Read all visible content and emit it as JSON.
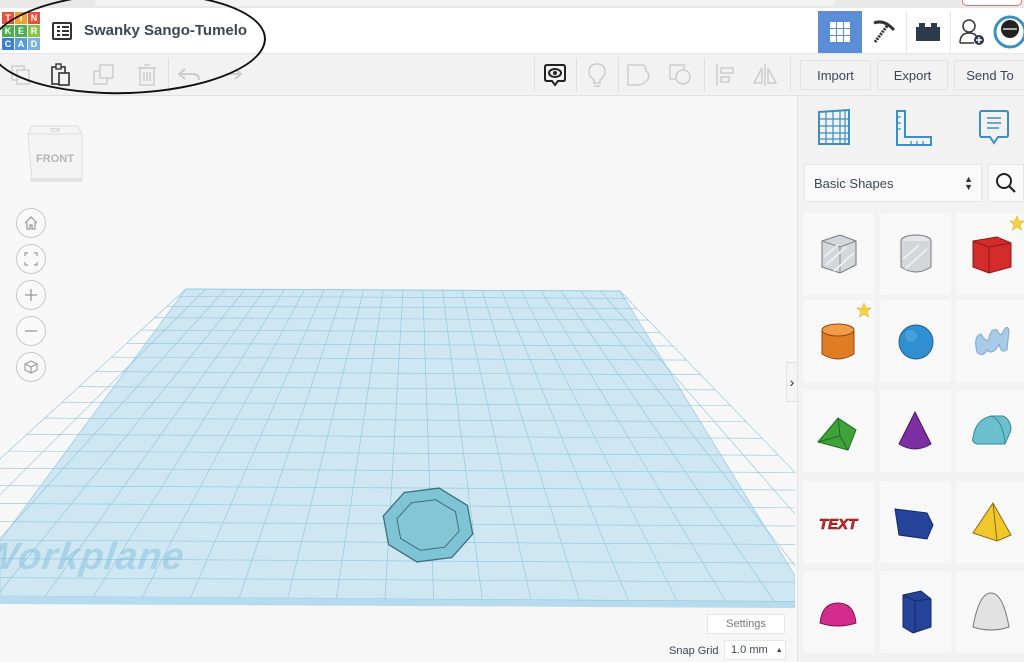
{
  "app": {
    "logo_letters": [
      "T",
      "I",
      "N",
      "K",
      "E",
      "R",
      "C",
      "A",
      "D"
    ],
    "logo_colors": [
      "#e8503a",
      "#f0a030",
      "#e8503a",
      "#4caf50",
      "#4caf50",
      "#8bc34a",
      "#3d7fcf",
      "#5b9bd5",
      "#7ab3e0"
    ]
  },
  "header": {
    "design_title": "Swanky Sango-Tumelo",
    "design_list_icon": "list-icon",
    "view_buttons": [
      {
        "name": "3d-design-view",
        "icon": "grid-icon",
        "active": true
      },
      {
        "name": "codeblocks-view",
        "icon": "pickaxe-icon",
        "active": false
      },
      {
        "name": "bricks-view",
        "icon": "brick-icon",
        "active": false
      },
      {
        "name": "invite-user",
        "icon": "add-user-icon",
        "active": false
      },
      {
        "name": "user-avatar",
        "icon": "avatar-icon",
        "active": false
      }
    ],
    "accent_color": "#5b8ed6"
  },
  "toolbar": {
    "edit_tools": [
      "copy",
      "paste",
      "duplicate",
      "delete"
    ],
    "history_tools": [
      "undo",
      "redo"
    ],
    "view_tools": [
      "show-all-notes",
      "light",
      "group",
      "ungroup",
      "align",
      "mirror"
    ],
    "import_label": "Import",
    "export_label": "Export",
    "send_to_label": "Send To"
  },
  "viewport": {
    "view_cube": {
      "top_label": "TOP",
      "front_label": "FRONT"
    },
    "nav_controls": [
      "home",
      "fit-all",
      "zoom-in",
      "zoom-out",
      "perspective"
    ],
    "workplane_label": "Workplane",
    "object": {
      "shape": "octagon-polygon",
      "color": "#7ec4d4"
    },
    "settings_label": "Settings",
    "snap_grid_label": "Snap Grid",
    "snap_grid_value": "1.0 mm",
    "collapse_handle": "›"
  },
  "panel": {
    "top_icons": [
      "workplane-icon",
      "ruler-icon",
      "notes-icon"
    ],
    "library_select": "Basic Shapes",
    "shapes": [
      {
        "name": "box-hole",
        "color": "#c8ccd2",
        "starred": false
      },
      {
        "name": "cylinder-hole",
        "color": "#c8ccd2",
        "starred": false
      },
      {
        "name": "box",
        "color": "#d42b2b",
        "starred": true
      },
      {
        "name": "cylinder",
        "color": "#e07c24",
        "starred": true
      },
      {
        "name": "sphere",
        "color": "#2f8fd0",
        "starred": false
      },
      {
        "name": "scribble",
        "color": "#a9cbe8",
        "starred": false
      },
      {
        "name": "roof",
        "color": "#3fa23a",
        "starred": false
      },
      {
        "name": "cone",
        "color": "#7b2fa3",
        "starred": false
      },
      {
        "name": "round-roof",
        "color": "#6cbfcc",
        "starred": false
      },
      {
        "name": "text",
        "color": "#d42b2b",
        "starred": false
      },
      {
        "name": "wedge",
        "color": "#26439a",
        "starred": false
      },
      {
        "name": "pyramid",
        "color": "#f1c72c",
        "starred": false
      },
      {
        "name": "half-sphere",
        "color": "#d42b8c",
        "starred": false
      },
      {
        "name": "polygon",
        "color": "#26439a",
        "starred": false
      },
      {
        "name": "paraboloid",
        "color": "#e2e2e2",
        "starred": false
      }
    ],
    "text_shape_label": "TEXT"
  }
}
